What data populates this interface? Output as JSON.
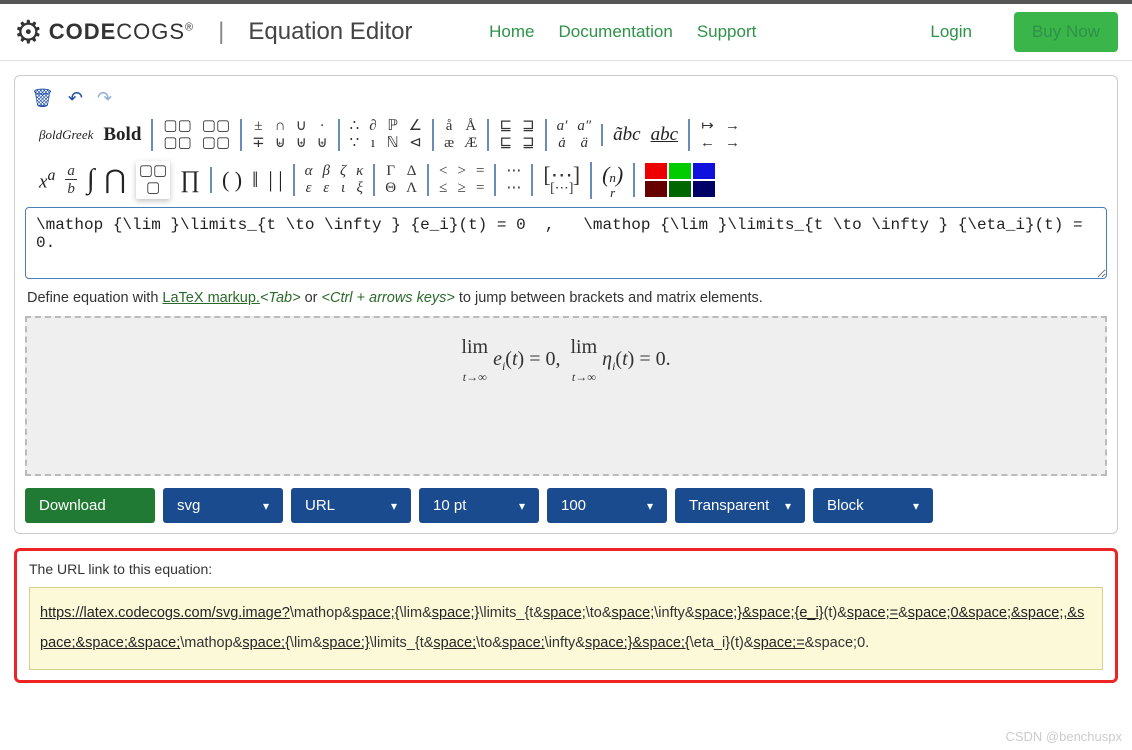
{
  "brand": {
    "name_a": "CODE",
    "name_b": "COGS",
    "reg": "®"
  },
  "page_title": "Equation Editor",
  "nav": {
    "home": "Home",
    "docs": "Documentation",
    "support": "Support",
    "login": "Login",
    "buy": "Buy Now"
  },
  "toolbar": {
    "boldgreek": "βoldGreek",
    "bold": "Bold"
  },
  "latex_input": "\\mathop {\\lim }\\limits_{t \\to \\infty } {e_i}(t) = 0  ,   \\mathop {\\lim }\\limits_{t \\to \\infty } {\\eta_i}(t) = 0.",
  "hint": {
    "prefix": "Define equation with ",
    "link": "LaTeX markup.",
    "tab": "<Tab>",
    "or": " or ",
    "ctrl": "<Ctrl + arrows keys>",
    "suffix": " to jump between brackets and matrix elements."
  },
  "preview_text": "lim e_i(t) = 0, lim η_i(t) = 0.",
  "controls": {
    "download": "Download",
    "format": "svg",
    "render": "URL",
    "size": "10 pt",
    "zoom": "100",
    "bg": "Transparent",
    "display": "Block"
  },
  "url_section": {
    "label": "The URL link to this equation:",
    "base": "https://latex.codecogs.com/svg.image?",
    "rest_parts": [
      {
        "t": "\\mathop&",
        "u": 0
      },
      {
        "t": "space;{",
        "u": 1
      },
      {
        "t": "\\lim&",
        "u": 0
      },
      {
        "t": "space;}",
        "u": 1
      },
      {
        "t": "\\limits_{t&",
        "u": 0
      },
      {
        "t": "space;",
        "u": 1
      },
      {
        "t": "\\to&",
        "u": 0
      },
      {
        "t": "space;",
        "u": 1
      },
      {
        "t": "\\infty&",
        "u": 0
      },
      {
        "t": "space;}&space;{e_i}",
        "u": 1
      },
      {
        "t": "(t)&",
        "u": 0
      },
      {
        "t": "space;=",
        "u": 1
      },
      {
        "t": "&",
        "u": 0
      },
      {
        "t": "space;0&space;&space;,&space;&space;&space;",
        "u": 1
      },
      {
        "t": "\\mathop&",
        "u": 0
      },
      {
        "t": "space;{",
        "u": 1
      },
      {
        "t": "\\lim&",
        "u": 0
      },
      {
        "t": "space;}",
        "u": 1
      },
      {
        "t": "\\limits_{t&",
        "u": 0
      },
      {
        "t": "space;",
        "u": 1
      },
      {
        "t": "\\to&",
        "u": 0
      },
      {
        "t": "space;",
        "u": 1
      },
      {
        "t": "\\infty&",
        "u": 0
      },
      {
        "t": "space;}&space;{",
        "u": 1
      },
      {
        "t": "\\eta_i}",
        "u": 0
      },
      {
        "t": "(t)&",
        "u": 0
      },
      {
        "t": "space;=",
        "u": 1
      },
      {
        "t": "&",
        "u": 0
      },
      {
        "t": "space;0.",
        "u": 0
      }
    ]
  },
  "watermark": "CSDN @benchuspx"
}
